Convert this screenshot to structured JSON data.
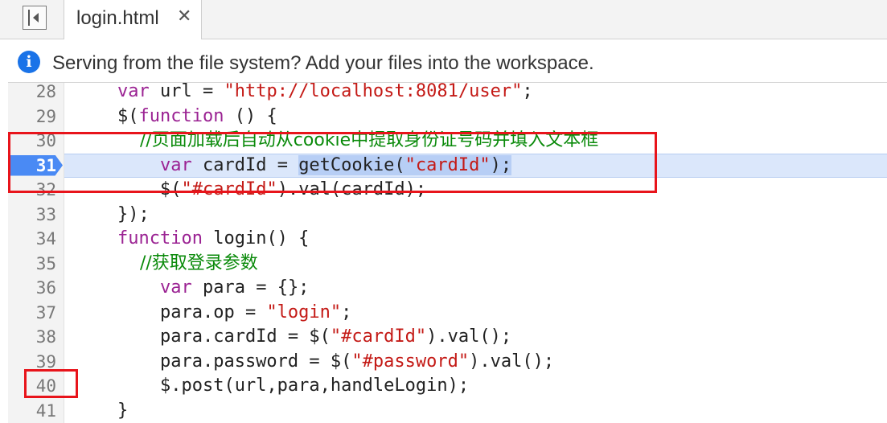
{
  "tabbar": {
    "tab_label": "login.html",
    "close_glyph": "✕",
    "toggle_icon": "sidebar-toggle-icon"
  },
  "infobar": {
    "icon": "info-icon",
    "icon_glyph": "i",
    "text": "Serving from the file system? Add your files into the workspace."
  },
  "editor": {
    "execution_line": "31",
    "lines": [
      {
        "num": "28",
        "parts": [
          [
            "kw",
            "var"
          ],
          [
            "p",
            " url = "
          ],
          [
            "str",
            "\"http://localhost:8081/user\""
          ],
          [
            "p",
            ";"
          ]
        ]
      },
      {
        "num": "29",
        "parts": [
          [
            "p",
            "$("
          ],
          [
            "kw",
            "function"
          ],
          [
            "p",
            " () {"
          ]
        ]
      },
      {
        "num": "30",
        "parts": [
          [
            "com",
            "    //页面加载后自动从cookie中提取身份证号码并填入文本框"
          ]
        ]
      },
      {
        "num": "31",
        "parts": [
          [
            "p",
            "    "
          ],
          [
            "kw",
            "var"
          ],
          [
            "p",
            " cardId = "
          ],
          [
            "sel",
            "getCookie("
          ],
          [
            "selstr",
            "\"cardId\""
          ],
          [
            "sel",
            ");"
          ]
        ]
      },
      {
        "num": "32",
        "parts": [
          [
            "p",
            "    $("
          ],
          [
            "str",
            "\"#cardId\""
          ],
          [
            "p",
            ").val(cardId);"
          ]
        ]
      },
      {
        "num": "33",
        "parts": [
          [
            "p",
            "});"
          ]
        ]
      },
      {
        "num": "34",
        "parts": [
          [
            "kw",
            "function"
          ],
          [
            "p",
            " login() {"
          ]
        ]
      },
      {
        "num": "35",
        "parts": [
          [
            "com",
            "    //获取登录参数"
          ]
        ]
      },
      {
        "num": "36",
        "parts": [
          [
            "p",
            "    "
          ],
          [
            "kw",
            "var"
          ],
          [
            "p",
            " para = {};"
          ]
        ]
      },
      {
        "num": "37",
        "parts": [
          [
            "p",
            "    para.op = "
          ],
          [
            "str",
            "\"login\""
          ],
          [
            "p",
            ";"
          ]
        ]
      },
      {
        "num": "38",
        "parts": [
          [
            "p",
            "    para.cardId = $("
          ],
          [
            "str",
            "\"#cardId\""
          ],
          [
            "p",
            ").val();"
          ]
        ]
      },
      {
        "num": "39",
        "parts": [
          [
            "p",
            "    para.password = $("
          ],
          [
            "str",
            "\"#password\""
          ],
          [
            "p",
            ").val();"
          ]
        ]
      },
      {
        "num": "40",
        "parts": [
          [
            "p",
            "    $.post(url,para,handleLogin);"
          ]
        ]
      },
      {
        "num": "41",
        "parts": [
          [
            "p",
            "}"
          ]
        ]
      }
    ]
  },
  "colors": {
    "keyword": "#9b2393",
    "string": "#c41a16",
    "comment": "#0a8a0a",
    "exec_marker": "#4a8af4",
    "annotation": "#e8141b"
  }
}
